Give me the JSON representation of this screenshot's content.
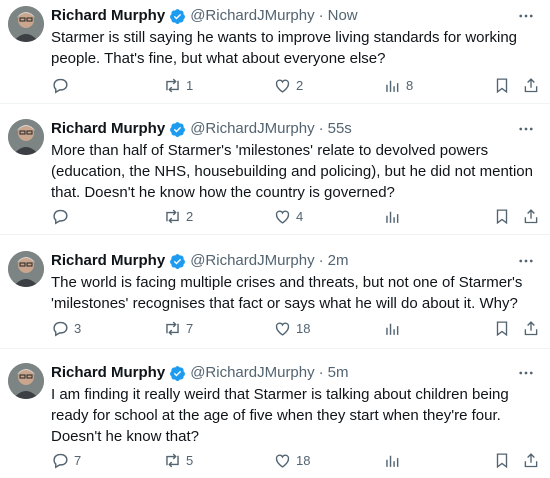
{
  "tweets": [
    {
      "name": "Richard Murphy",
      "handle": "@RichardJMurphy",
      "time": "Now",
      "text": "Starmer is still saying he wants to improve living standards for working people. That's fine, but what about everyone else?",
      "replies": "",
      "retweets": "1",
      "likes": "2",
      "views": "8"
    },
    {
      "name": "Richard Murphy",
      "handle": "@RichardJMurphy",
      "time": "55s",
      "text": "More than half of Starmer's 'milestones' relate to devolved powers (education, the NHS, housebuilding and policing), but he did not mention that. Doesn't he know how the country is governed?",
      "replies": "",
      "retweets": "2",
      "likes": "4",
      "views": ""
    },
    {
      "name": "Richard Murphy",
      "handle": "@RichardJMurphy",
      "time": "2m",
      "text": "The world is facing multiple crises and threats, but not one of Starmer's 'milestones' recognises that fact or says what he will do about it. Why?",
      "replies": "3",
      "retweets": "7",
      "likes": "18",
      "views": ""
    },
    {
      "name": "Richard Murphy",
      "handle": "@RichardJMurphy",
      "time": "5m",
      "text": "I am finding it really weird that Starmer is talking about children being ready for school at the age of five when they start when they're four. Doesn't he know that?",
      "replies": "7",
      "retweets": "5",
      "likes": "18",
      "views": ""
    }
  ],
  "colors": {
    "text": "#0f1419",
    "secondary": "#536471",
    "verified": "#1d9bf0",
    "divider": "#eff3f4"
  },
  "icons": [
    "verified-badge-icon",
    "more-icon",
    "reply-icon",
    "retweet-icon",
    "like-icon",
    "views-icon",
    "bookmark-icon",
    "share-icon"
  ]
}
